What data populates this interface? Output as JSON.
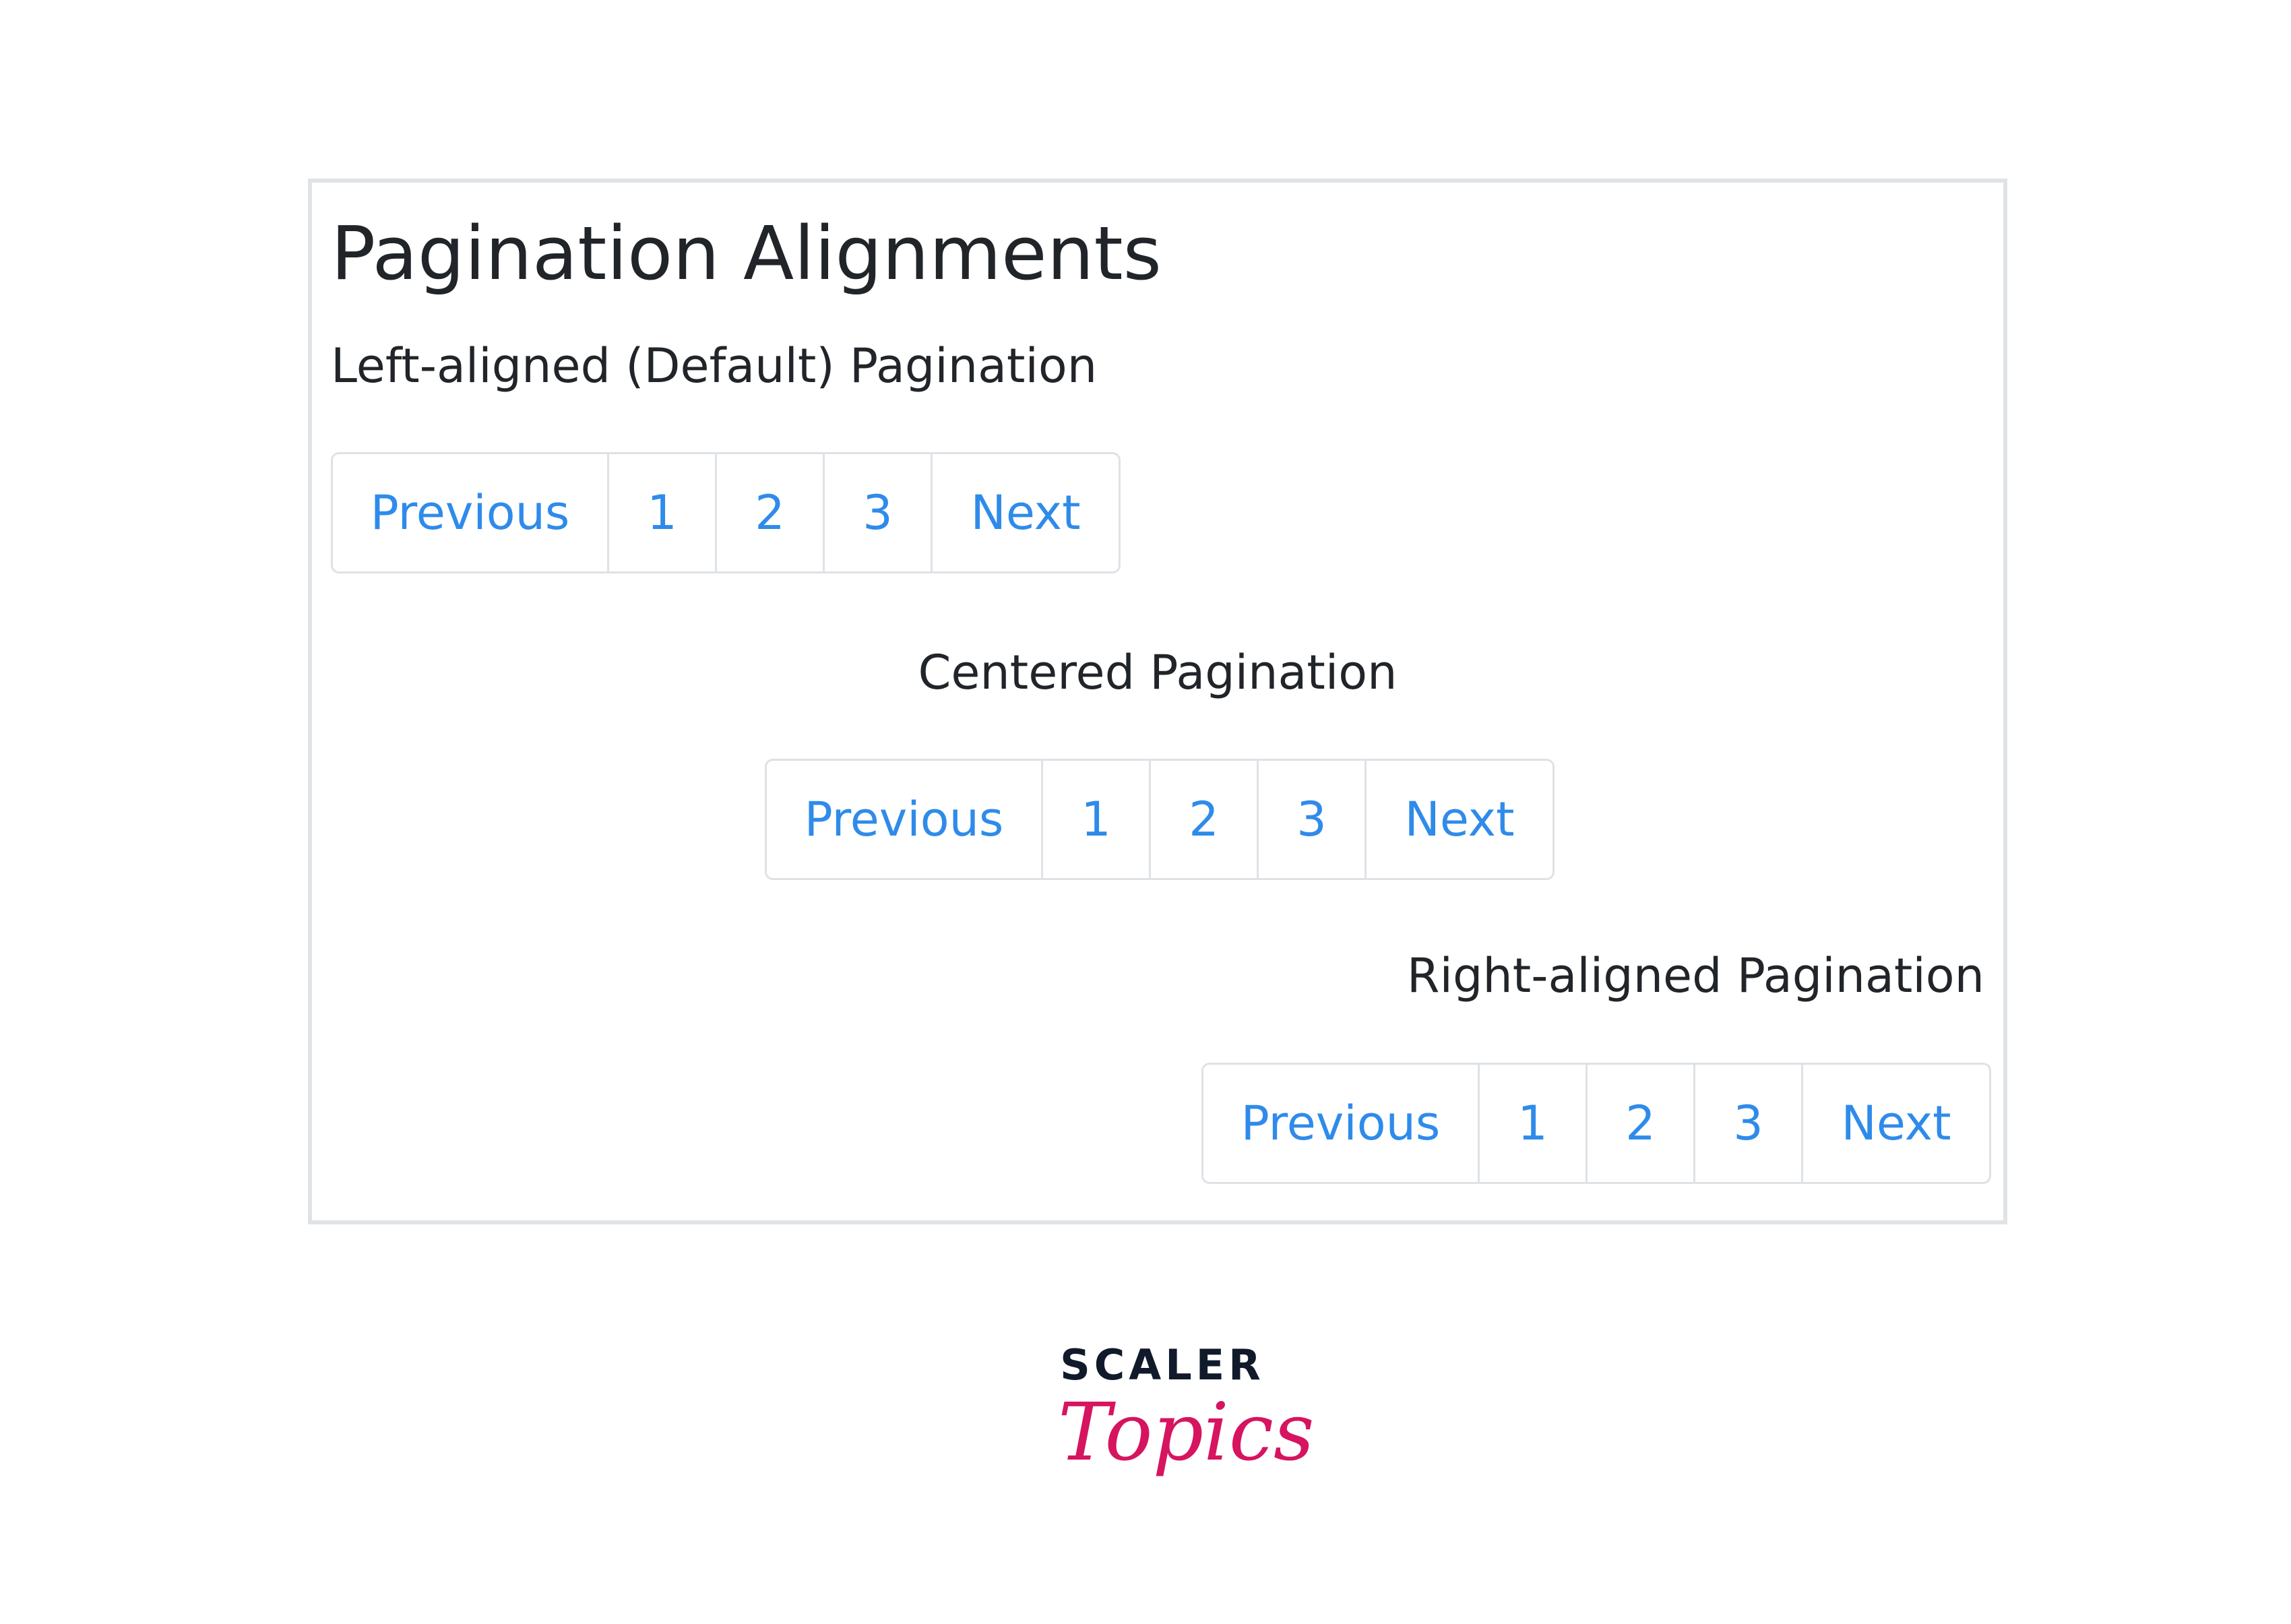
{
  "page": {
    "title": "Pagination Alignments"
  },
  "sections": {
    "left": {
      "label": "Left-aligned (Default) Pagination",
      "items": [
        "Previous",
        "1",
        "2",
        "3",
        "Next"
      ]
    },
    "center": {
      "label": "Centered Pagination",
      "items": [
        "Previous",
        "1",
        "2",
        "3",
        "Next"
      ]
    },
    "right": {
      "label": "Right-aligned Pagination",
      "items": [
        "Previous",
        "1",
        "2",
        "3",
        "Next"
      ]
    }
  },
  "brand": {
    "line1": "SCALER",
    "line2": "Topics"
  },
  "colors": {
    "link": "#2f8bea",
    "text": "#212529",
    "border": "#dee2e6",
    "brand_dark": "#101a2b",
    "brand_pink": "#d6145f"
  }
}
